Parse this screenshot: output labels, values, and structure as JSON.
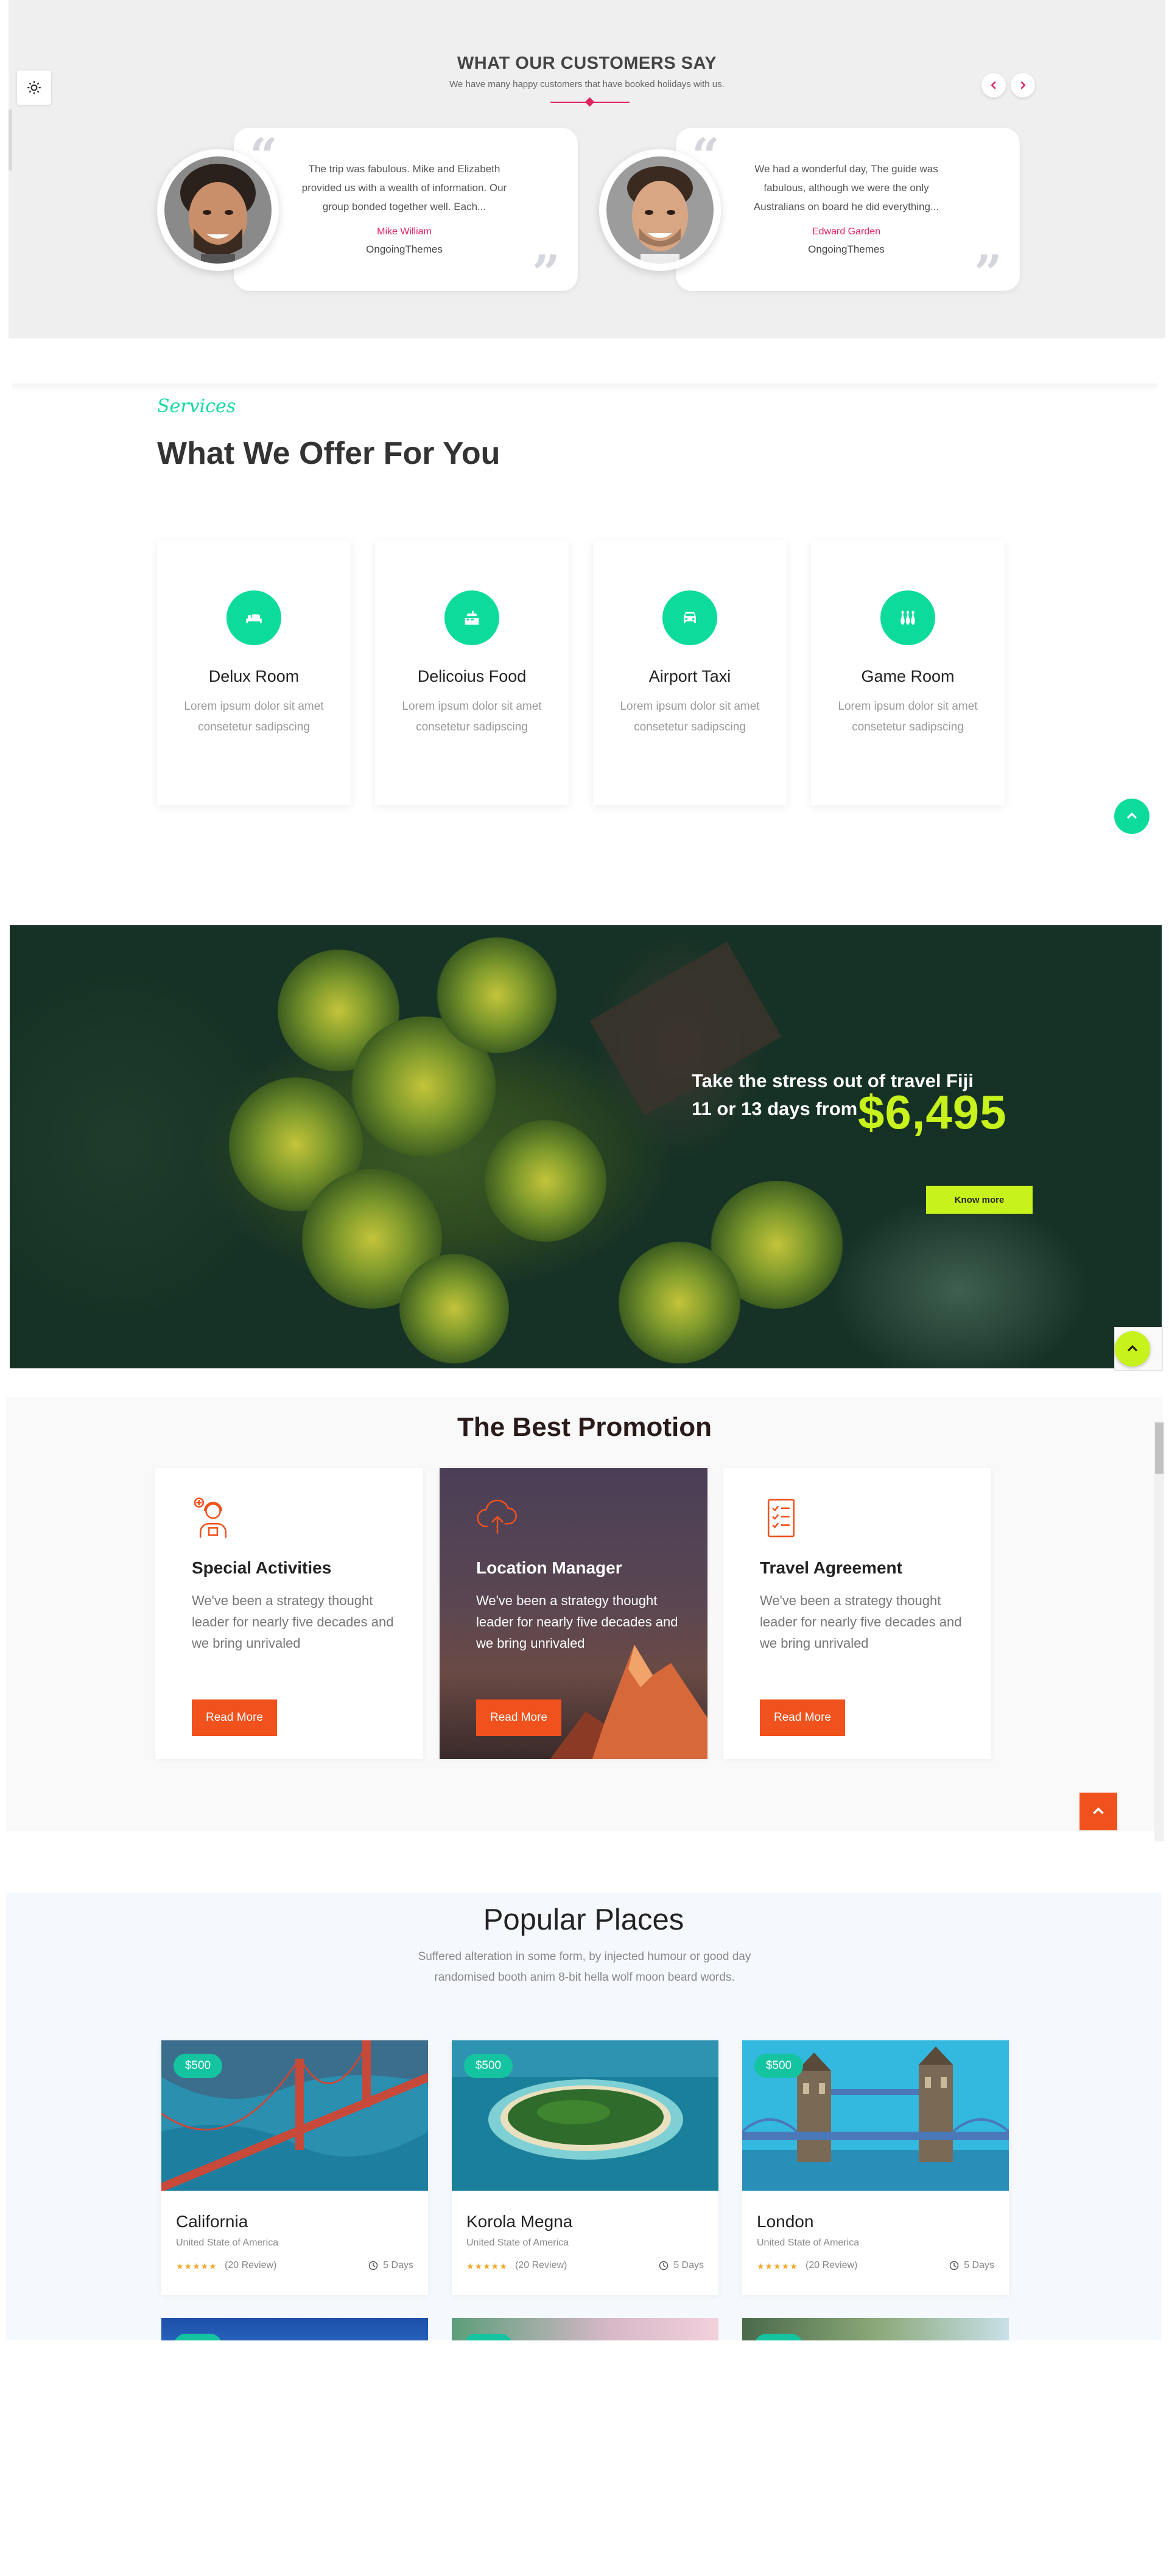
{
  "testimonials": {
    "title": "WHAT OUR CUSTOMERS SAY",
    "subtitle": "We have many happy customers that have booked holidays with us.",
    "items": [
      {
        "text": "The trip was fabulous. Mike and Elizabeth provided us with a wealth of information. Our group bonded together well. Each...",
        "name": "Mike William",
        "company": "OngoingThemes"
      },
      {
        "text": "We had a wonderful day, The guide was fabulous, although we were the only Australians on board he did everything...",
        "name": "Edward Garden",
        "company": "OngoingThemes"
      }
    ]
  },
  "services": {
    "kicker": "Services",
    "title": "What We Offer For You",
    "items": [
      {
        "name": "Delux Room",
        "desc": "Lorem ipsum dolor sit amet consetetur sadipscing",
        "icon": "bed-icon"
      },
      {
        "name": "Delicoius Food",
        "desc": "Lorem ipsum dolor sit amet consetetur sadipscing",
        "icon": "food-icon"
      },
      {
        "name": "Airport Taxi",
        "desc": "Lorem ipsum dolor sit amet consetetur sadipscing",
        "icon": "taxi-icon"
      },
      {
        "name": "Game Room",
        "desc": "Lorem ipsum dolor sit amet consetetur sadipscing",
        "icon": "bowling-icon"
      }
    ]
  },
  "banner": {
    "line1": "Take the stress out of travel Fiji",
    "line2": "11 or 13 days from",
    "price": "$6,495",
    "button": "Know more"
  },
  "promotion": {
    "title": "The Best Promotion",
    "items": [
      {
        "name": "Special Activities",
        "desc": "We've been a strategy thought leader for nearly five decades and we bring unrivaled",
        "button": "Read More",
        "icon": "user-support-icon"
      },
      {
        "name": "Location Manager",
        "desc": "We've been a strategy thought leader for nearly five decades and we bring unrivaled",
        "button": "Read More",
        "icon": "cloud-upload-icon"
      },
      {
        "name": "Travel Agreement",
        "desc": "We've been a strategy thought leader for nearly five decades and we bring unrivaled",
        "button": "Read More",
        "icon": "checklist-icon"
      }
    ]
  },
  "places": {
    "title": "Popular Places",
    "desc": "Suffered alteration in some form, by injected humour or good day randomised booth anim 8-bit hella wolf moon beard words.",
    "items": [
      {
        "price": "$500",
        "name": "California",
        "location": "United State of America",
        "stars": "★★★★★",
        "reviews": "(20 Review)",
        "days": "5 Days"
      },
      {
        "price": "$500",
        "name": "Korola Megna",
        "location": "United State of America",
        "stars": "★★★★★",
        "reviews": "(20 Review)",
        "days": "5 Days"
      },
      {
        "price": "$500",
        "name": "London",
        "location": "United State of America",
        "stars": "★★★★★",
        "reviews": "(20 Review)",
        "days": "5 Days"
      }
    ]
  },
  "colors": {
    "testimonial_accent": "#e0245e",
    "service_green": "#0ddb9c",
    "banner_lime": "#c8f21b",
    "promo_orange": "#f0511d",
    "places_teal": "#14c4a0"
  }
}
